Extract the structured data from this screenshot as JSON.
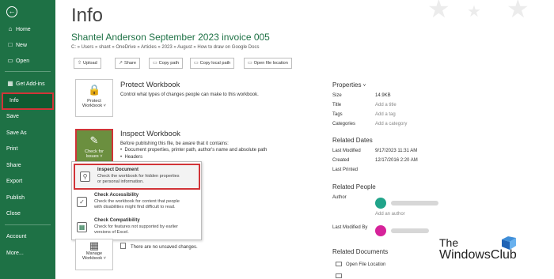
{
  "sidebar": {
    "back_icon": "back-arrow-icon",
    "items": [
      {
        "label": "Home",
        "icon": "home-icon"
      },
      {
        "label": "New",
        "icon": "new-file-icon"
      },
      {
        "label": "Open",
        "icon": "folder-icon"
      },
      {
        "label": "Get Add-ins",
        "icon": "grid-icon"
      },
      {
        "label": "Info",
        "selected": true
      },
      {
        "label": "Save"
      },
      {
        "label": "Save As"
      },
      {
        "label": "Print"
      },
      {
        "label": "Share"
      },
      {
        "label": "Export"
      },
      {
        "label": "Publish"
      },
      {
        "label": "Close"
      },
      {
        "label": "Account"
      },
      {
        "label": "More..."
      }
    ]
  },
  "header": {
    "title": "Info",
    "file_name": "Shantel Anderson September 2023 invoice 005",
    "path": "C: » Users » shant » OneDrive » Articles » 2023 » August » How to draw on Google Docs"
  },
  "actions": [
    "Upload",
    "Share",
    "Copy path",
    "Copy local path",
    "Open file location"
  ],
  "protect": {
    "tile_line1": "Protect",
    "tile_line2": "Workbook",
    "title": "Protect Workbook",
    "desc": "Control what types of changes people can make to this workbook."
  },
  "inspect": {
    "tile_line1": "Check for",
    "tile_line2": "Issues",
    "title": "Inspect Workbook",
    "desc": "Before publishing this file, be aware that it contains:",
    "bullets": [
      "Document properties, printer path, author's name and absolute path",
      "Headers"
    ]
  },
  "dropdown": [
    {
      "title": "Inspect Document",
      "desc1": "Check the workbook for hidden properties",
      "desc2": "or personal information."
    },
    {
      "title": "Check Accessibility",
      "desc1": "Check the workbook for content that people",
      "desc2": "with disabilities might find difficult to read."
    },
    {
      "title": "Check Compatibility",
      "desc1": "Check for features not supported by earlier",
      "desc2": "versions of Excel."
    }
  ],
  "manage": {
    "tile_line1": "Manage",
    "tile_line2": "Workbook",
    "status": "There are no unsaved changes."
  },
  "properties": {
    "heading": "Properties",
    "rows": [
      {
        "label": "Size",
        "value": "14.9KB"
      },
      {
        "label": "Title",
        "value": "Add a title"
      },
      {
        "label": "Tags",
        "value": "Add a tag"
      },
      {
        "label": "Categories",
        "value": "Add a category"
      }
    ]
  },
  "related_dates": {
    "heading": "Related Dates",
    "rows": [
      {
        "label": "Last Modified",
        "value": "9/17/2023 11:31 AM"
      },
      {
        "label": "Created",
        "value": "12/17/2016 2:20 AM"
      },
      {
        "label": "Last Printed",
        "value": ""
      }
    ]
  },
  "related_people": {
    "heading": "Related People",
    "author_label": "Author",
    "add_author": "Add an author",
    "last_modified_label": "Last Modified By"
  },
  "related_documents": {
    "heading": "Related Documents",
    "open_location": "Open File Location"
  },
  "watermark": {
    "line1": "The",
    "line2": "WindowsClub"
  },
  "colors": {
    "sidebar": "#1e7145",
    "accent_green": "#6b8f3f",
    "highlight_red": "#d13438"
  }
}
